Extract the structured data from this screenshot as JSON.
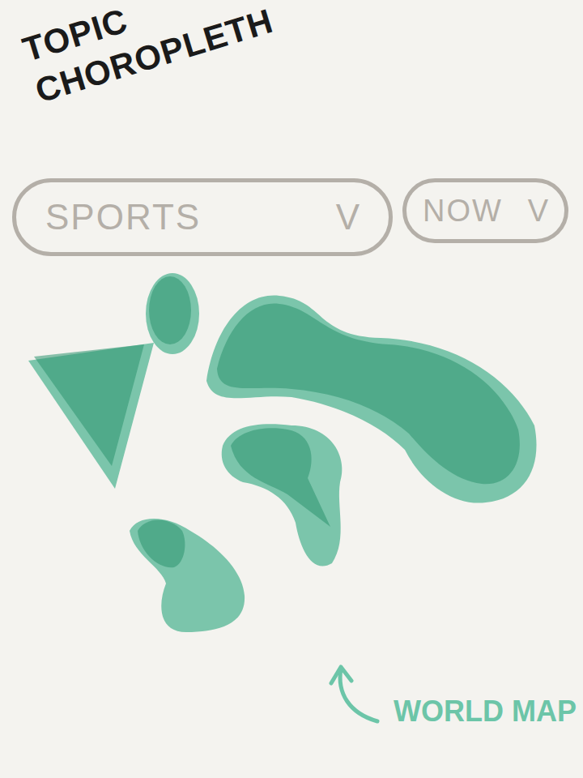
{
  "title": "TOPIC CHOROPLETH",
  "filters": [
    {
      "label": "SPORTS",
      "icon": "V"
    },
    {
      "label": "NOW",
      "icon": "V"
    }
  ],
  "map": {
    "annotation": "WORLD MAP"
  }
}
